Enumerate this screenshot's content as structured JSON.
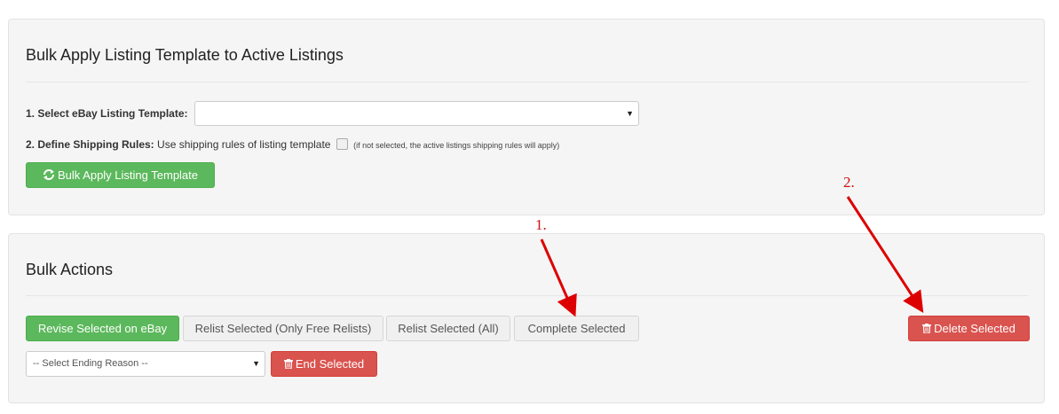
{
  "template_panel": {
    "title": "Bulk Apply Listing Template to Active Listings",
    "select_label": "1. Select eBay Listing Template:",
    "select_value": "",
    "shipping_label": "2. Define Shipping Rules:",
    "shipping_text": "Use shipping rules of listing template",
    "shipping_checked": false,
    "shipping_note": "(if not selected, the active listings shipping rules will apply)",
    "apply_button": "Bulk Apply Listing Template"
  },
  "bulk_panel": {
    "title": "Bulk Actions",
    "buttons": {
      "revise": "Revise Selected on eBay",
      "relist_free": "Relist Selected (Only Free Relists)",
      "relist_all": "Relist Selected (All)",
      "complete": "Complete Selected",
      "delete": "Delete Selected"
    },
    "ending_reason_select": "-- Select Ending Reason --",
    "end_button": "End Selected"
  },
  "annotations": {
    "first": "1.",
    "second": "2."
  },
  "colors": {
    "green": "#5cb85c",
    "red": "#d9534f",
    "annotation": "#cc1111"
  }
}
